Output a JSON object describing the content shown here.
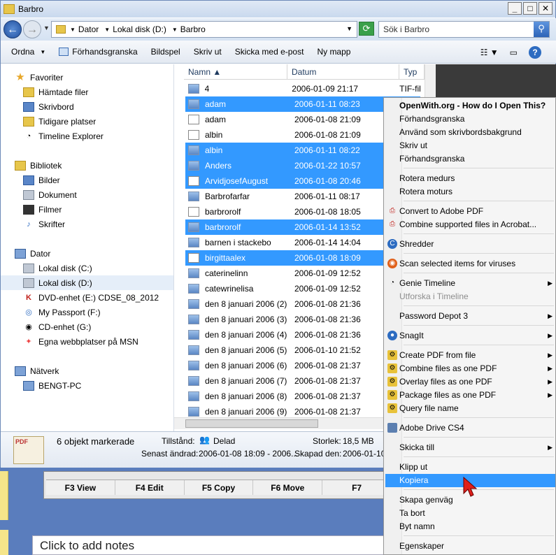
{
  "window": {
    "title": "Barbro"
  },
  "address": {
    "crumbs": [
      "Dator",
      "Lokal disk (D:)",
      "Barbro"
    ],
    "search_placeholder": "Sök i Barbro"
  },
  "toolbar": {
    "organize": "Ordna",
    "preview": "Förhandsgranska",
    "slideshow": "Bildspel",
    "print": "Skriv ut",
    "email": "Skicka med e-post",
    "newfolder": "Ny mapp"
  },
  "nav": {
    "favorites": "Favoriter",
    "downloads": "Hämtade filer",
    "desktop": "Skrivbord",
    "recent": "Tidigare platser",
    "timeline": "Timeline Explorer",
    "libraries": "Bibliotek",
    "pictures": "Bilder",
    "documents": "Dokument",
    "videos": "Filmer",
    "music": "Skrifter",
    "computer": "Dator",
    "drive_c": "Lokal disk (C:)",
    "drive_d": "Lokal disk (D:)",
    "dvd": "DVD-enhet (E:) CDSE_08_2012",
    "passport": "My Passport (F:)",
    "cd": "CD-enhet (G:)",
    "msn": "Egna webbplatser på MSN",
    "network": "Nätverk",
    "pc": "BENGT-PC"
  },
  "columns": {
    "name": "Namn",
    "date": "Datum",
    "type": "Typ"
  },
  "files": [
    {
      "name": "4",
      "date": "2006-01-09 21:17",
      "type": "TIF-fil"
    },
    {
      "name": "adam",
      "date": "2006-01-11 08:23",
      "type": ""
    },
    {
      "name": "adam",
      "date": "2006-01-08 21:09",
      "type": ""
    },
    {
      "name": "albin",
      "date": "2006-01-08 21:09",
      "type": ""
    },
    {
      "name": "albin",
      "date": "2006-01-11 08:22",
      "type": ""
    },
    {
      "name": "Anders",
      "date": "2006-01-22 10:57",
      "type": ""
    },
    {
      "name": "ArvidjosefAugust",
      "date": "2006-01-08 20:46",
      "type": ""
    },
    {
      "name": "Barbrofarfar",
      "date": "2006-01-11 08:17",
      "type": ""
    },
    {
      "name": "barbrorolf",
      "date": "2006-01-08 18:05",
      "type": ""
    },
    {
      "name": "barbrorolf",
      "date": "2006-01-14 13:52",
      "type": ""
    },
    {
      "name": "barnen i stackebo",
      "date": "2006-01-14 14:04",
      "type": ""
    },
    {
      "name": "birgittaalex",
      "date": "2006-01-08 18:09",
      "type": ""
    },
    {
      "name": "caterinelinn",
      "date": "2006-01-09 12:52",
      "type": ""
    },
    {
      "name": "catewrinelisa",
      "date": "2006-01-09 12:52",
      "type": ""
    },
    {
      "name": "den 8 januari 2006 (2)",
      "date": "2006-01-08 21:36",
      "type": ""
    },
    {
      "name": "den 8 januari 2006 (3)",
      "date": "2006-01-08 21:36",
      "type": ""
    },
    {
      "name": "den 8 januari 2006 (4)",
      "date": "2006-01-08 21:36",
      "type": ""
    },
    {
      "name": "den 8 januari 2006 (5)",
      "date": "2006-01-10 21:52",
      "type": ""
    },
    {
      "name": "den 8 januari 2006 (6)",
      "date": "2006-01-08 21:37",
      "type": ""
    },
    {
      "name": "den 8 januari 2006 (7)",
      "date": "2006-01-08 21:37",
      "type": ""
    },
    {
      "name": "den 8 januari 2006 (8)",
      "date": "2006-01-08 21:37",
      "type": ""
    },
    {
      "name": "den 8 januari 2006 (9)",
      "date": "2006-01-08 21:37",
      "type": ""
    }
  ],
  "details": {
    "selected": "6 objekt markerade",
    "state_label": "Tillstånd:",
    "state_value": "Delad",
    "size_label": "Storlek:",
    "size_value": "18,5 MB",
    "modified_label": "Senast ändrad:",
    "modified_value": "2006-01-08 18:09 - 2006...",
    "created_label": "Skapad den:",
    "created_value": "2006-01-10 ..."
  },
  "menu": {
    "openwith": "OpenWith.org - How do I Open This?",
    "preview1": "Förhandsgranska",
    "wallpaper": "Använd som skrivbordsbakgrund",
    "print": "Skriv ut",
    "preview2": "Förhandsgranska",
    "rotate_cw": "Rotera medurs",
    "rotate_ccw": "Rotera moturs",
    "convert_pdf": "Convert to Adobe PDF",
    "combine_acrobat": "Combine supported files in Acrobat...",
    "shredder": "Shredder",
    "scan": "Scan selected items for viruses",
    "genie": "Genie Timeline",
    "explore_timeline": "Utforska i Timeline",
    "password": "Password Depot 3",
    "snagit": "SnagIt",
    "create_pdf": "Create PDF from file",
    "combine_one": "Combine files as one PDF",
    "overlay": "Overlay files as one PDF",
    "package": "Package files as one PDF",
    "query": "Query file name",
    "adobe_drive": "Adobe Drive CS4",
    "sendto": "Skicka till",
    "cut": "Klipp ut",
    "copy": "Kopiera",
    "shortcut": "Skapa genväg",
    "delete": "Ta bort",
    "rename": "Byt namn",
    "properties": "Egenskaper"
  },
  "background": {
    "fkeys": [
      "F3 View",
      "F4 Edit",
      "F5 Copy",
      "F6 Move",
      "F7"
    ],
    "notes": "Click to add notes"
  }
}
